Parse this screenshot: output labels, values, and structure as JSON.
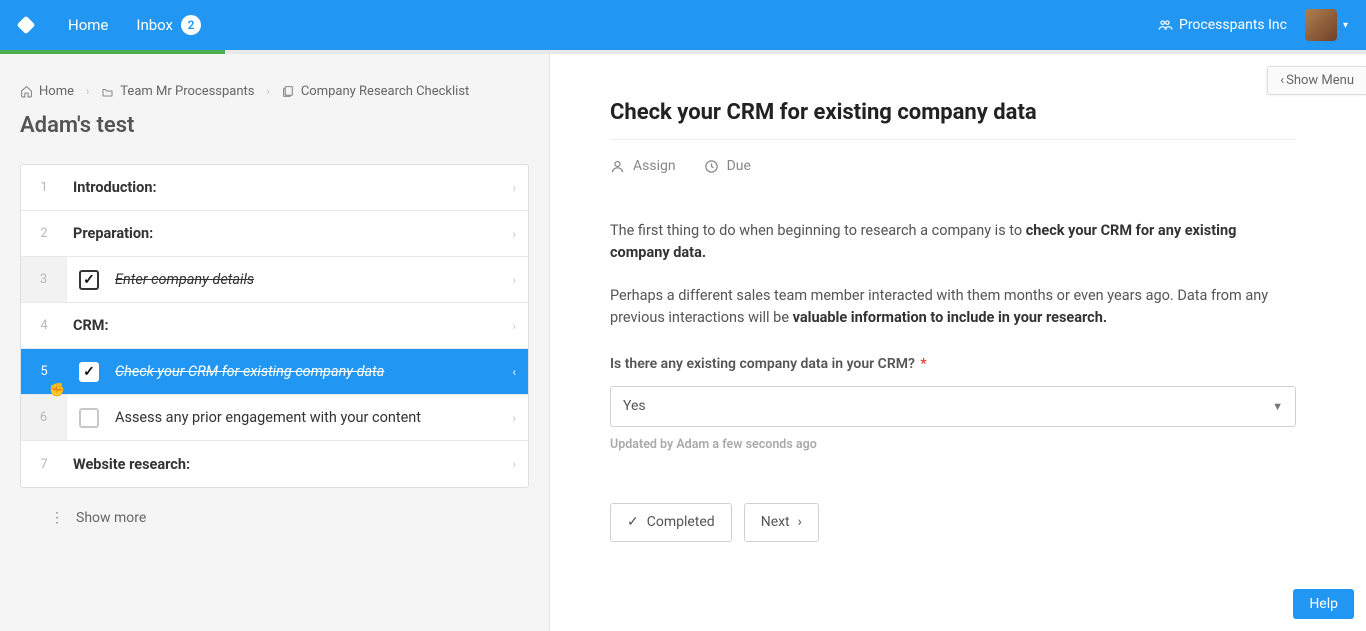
{
  "header": {
    "home": "Home",
    "inbox": "Inbox",
    "inbox_count": "2",
    "org_name": "Processpants Inc"
  },
  "breadcrumb": {
    "home": "Home",
    "team": "Team Mr Processpants",
    "template": "Company Research Checklist"
  },
  "page_title": "Adam's test",
  "steps": {
    "s1": {
      "num": "1",
      "label": "Introduction:"
    },
    "s2": {
      "num": "2",
      "label": "Preparation:"
    },
    "s3": {
      "num": "3",
      "label": "Enter company details"
    },
    "s4": {
      "num": "4",
      "label": "CRM:"
    },
    "s5": {
      "num": "5",
      "label": "Check your CRM for existing company data"
    },
    "s6": {
      "num": "6",
      "label": "Assess any prior engagement with your content"
    },
    "s7": {
      "num": "7",
      "label": "Website research:"
    }
  },
  "show_more": "Show more",
  "show_menu": "Show Menu",
  "detail": {
    "title": "Check your CRM for existing company data",
    "assign": "Assign",
    "due": "Due",
    "p1a": "The first thing to do when beginning to research a company is to ",
    "p1b": "check your CRM for any existing company data.",
    "p2a": "Perhaps a different sales team member interacted with them months or even years ago. Data from any previous interactions will be ",
    "p2b": "valuable information to include in your research.",
    "question": "Is there any existing company data in your CRM?",
    "required_mark": "*",
    "dropdown_value": "Yes",
    "meta": "Updated by Adam a few seconds ago",
    "completed_btn": "Completed",
    "next_btn": "Next"
  },
  "help": "Help"
}
